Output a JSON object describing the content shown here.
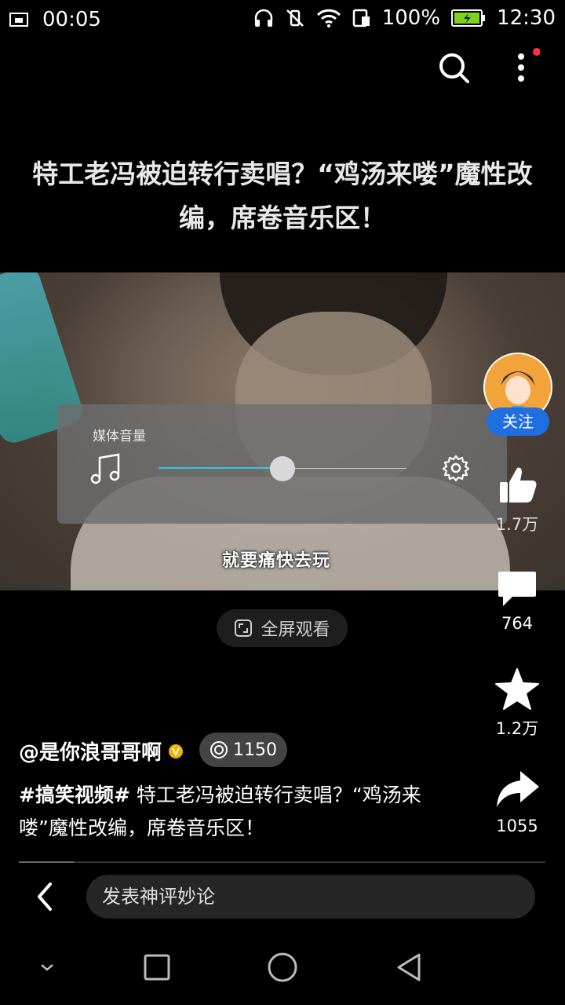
{
  "status_bar": {
    "time_left": "00:05",
    "battery": "100%",
    "clock": "12:30"
  },
  "post": {
    "title": "特工老冯被迫转行卖唱？“鸡汤来喽”魔性改编，席卷音乐区！",
    "subtitle": "就要痛快去玩",
    "fullscreen_label": "全屏观看",
    "author": "@是你浪哥哥啊",
    "coins": "1150",
    "hashtag": "#搞笑视频#",
    "description": " 特工老冯被迫转行卖唱？“鸡汤来喽”魔性改编，席卷音乐区！"
  },
  "volume": {
    "label": "媒体音量",
    "level": 0.5
  },
  "rail": {
    "follow": "关注",
    "likes": "1.7万",
    "comments": "764",
    "favorites": "1.2万",
    "shares": "1055"
  },
  "comment_bar": {
    "placeholder": "发表神评妙论"
  },
  "colors": {
    "accent_blue": "#1f6fe0",
    "volume_fill": "#35c7e0",
    "battery_green": "#7ed321"
  }
}
